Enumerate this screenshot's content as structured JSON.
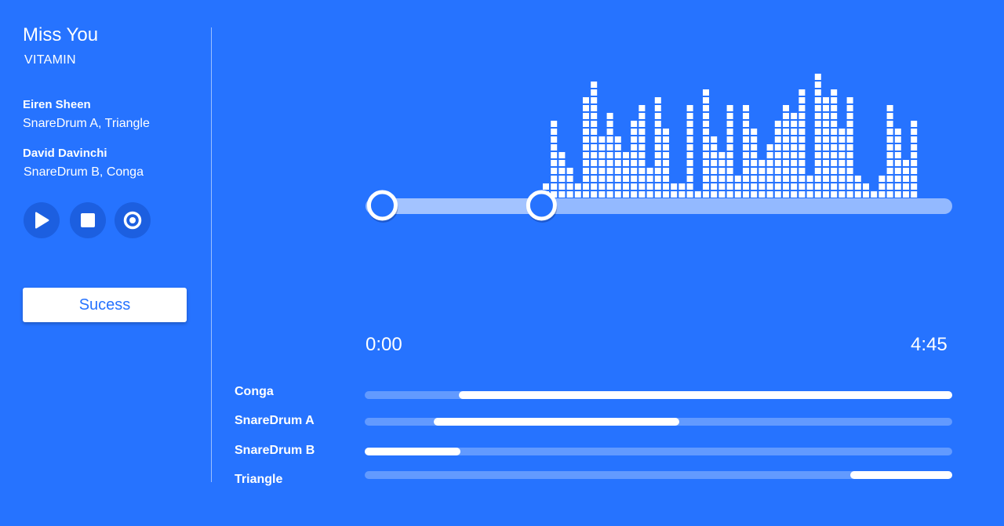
{
  "song": {
    "title": "Miss You",
    "album": "VITAMIN"
  },
  "artists": [
    {
      "name": "Eiren Sheen",
      "roles": "SnareDrum A, Triangle"
    },
    {
      "name": "David Davinchi",
      "roles": "SnareDrum B, Conga"
    }
  ],
  "controls": {
    "play_icon": "play-icon",
    "stop_icon": "stop-icon",
    "record_icon": "record-icon"
  },
  "success_button": {
    "label": "Sucess"
  },
  "player": {
    "time_start": "0:00",
    "time_end": "4:45",
    "selection_start_fraction": 0.03,
    "selection_end_fraction": 0.3
  },
  "equalizer_levels": [
    2,
    10,
    6,
    4,
    2,
    13,
    15,
    8,
    11,
    8,
    6,
    10,
    12,
    4,
    13,
    9,
    2,
    2,
    12,
    1,
    14,
    8,
    6,
    12,
    3,
    12,
    9,
    5,
    7,
    10,
    12,
    11,
    14,
    3,
    16,
    13,
    14,
    9,
    13,
    3,
    2,
    1,
    3,
    12,
    9,
    5,
    10
  ],
  "tracks": [
    {
      "name": "Conga",
      "start": 0.16,
      "end": 1.0
    },
    {
      "name": "SnareDrum A",
      "start": 0.117,
      "end": 0.535
    },
    {
      "name": "SnareDrum B",
      "start": 0.0,
      "end": 0.163
    },
    {
      "name": "Triangle",
      "start": 0.826,
      "end": 1.0
    }
  ],
  "colors": {
    "background": "#2673ff",
    "control_bg": "#1c5fe0",
    "accent": "#ffffff"
  }
}
